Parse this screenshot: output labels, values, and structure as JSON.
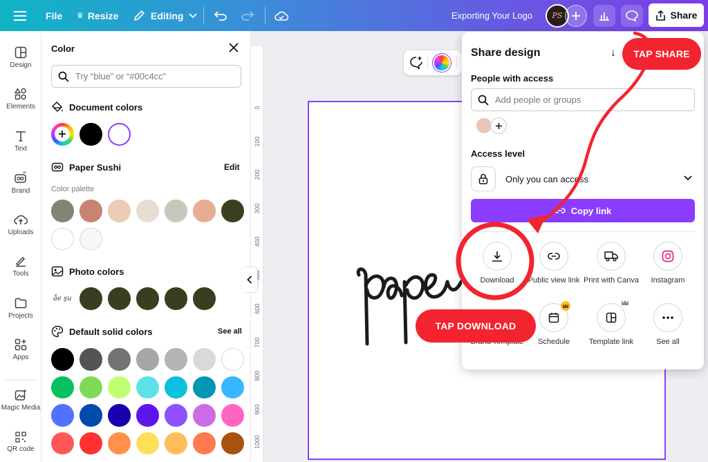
{
  "topbar": {
    "file_label": "File",
    "resize_label": "Resize",
    "editing_label": "Editing",
    "doc_title": "Exporting Your Logo",
    "share_label": "Share",
    "avatar_initials": "PS"
  },
  "rail": {
    "items": [
      {
        "label": "Design",
        "icon": "design-icon"
      },
      {
        "label": "Elements",
        "icon": "elements-icon"
      },
      {
        "label": "Text",
        "icon": "text-icon"
      },
      {
        "label": "Brand",
        "icon": "brand-icon"
      },
      {
        "label": "Uploads",
        "icon": "uploads-icon"
      },
      {
        "label": "Tools",
        "icon": "tools-icon"
      },
      {
        "label": "Projects",
        "icon": "projects-icon"
      },
      {
        "label": "Apps",
        "icon": "apps-icon"
      },
      {
        "label": "Magic Media",
        "icon": "magic-media-icon"
      },
      {
        "label": "QR code",
        "icon": "qr-code-icon"
      }
    ]
  },
  "color_panel": {
    "title": "Color",
    "search_placeholder": "Try “blue” or “#00c4cc”",
    "document_colors_label": "Document colors",
    "document_colors": [
      "#000000",
      "#ffffff"
    ],
    "brand_kit_name": "Paper Sushi",
    "edit_label": "Edit",
    "palette_label": "Color palette",
    "palette": [
      "#838476",
      "#c98372",
      "#ecccb4",
      "#e6ddd3",
      "#c4c9bb",
      "#e7ad92",
      "#3b3f1f",
      "#ffffff",
      "#faf6f4"
    ],
    "photo_colors_label": "Photo colors",
    "photo_thumb_text": "åe şu",
    "photo_colors": [
      "#3a3d20",
      "#3a3d20",
      "#3a3d20",
      "#3a3d20",
      "#3a3d20"
    ],
    "default_colors_label": "Default solid colors",
    "see_all_label": "See all",
    "default_colors": [
      [
        "#000000",
        "#545454",
        "#737373",
        "#a6a6a6",
        "#b4b4b4",
        "#d9d9d9",
        "#ffffff"
      ],
      [
        "#05c15e",
        "#7ed957",
        "#c1ff72",
        "#5ce1e6",
        "#0cc0df",
        "#0097b2",
        "#38b6ff"
      ],
      [
        "#5271ff",
        "#004aad",
        "#1800ad",
        "#5e17eb",
        "#8c52ff",
        "#cb6ce6",
        "#ff66c4"
      ],
      [
        "#ff5757",
        "#ff3131",
        "#ff914d",
        "#ffde59",
        "#ffbd59",
        "#ff7a4d",
        "#a8520f"
      ]
    ]
  },
  "canvas": {
    "ruler_ticks": [
      "0",
      "100",
      "200",
      "300",
      "400",
      "500",
      "600",
      "700",
      "800",
      "900",
      "1000"
    ],
    "logo_text": "paper"
  },
  "share_popup": {
    "title": "Share design",
    "people_label": "People with access",
    "people_placeholder": "Add people or groups",
    "access_label": "Access level",
    "access_value": "Only you can access",
    "copy_link_label": "Copy link",
    "options": [
      {
        "label": "Download",
        "icon": "download-icon"
      },
      {
        "label": "Public view link",
        "icon": "link-icon"
      },
      {
        "label": "Print with Canva",
        "icon": "truck-icon"
      },
      {
        "label": "Instagram",
        "icon": "instagram-icon"
      },
      {
        "label": "Brand Template",
        "icon": "brand-template-icon"
      },
      {
        "label": "Schedule",
        "icon": "calendar-icon"
      },
      {
        "label": "Template link",
        "icon": "template-link-icon"
      },
      {
        "label": "See all",
        "icon": "more-icon"
      }
    ]
  },
  "annotations": {
    "tap_share": "TAP SHARE",
    "tap_download": "TAP DOWNLOAD",
    "color": "#f2242f"
  },
  "colors": {
    "accent": "#8b3dff",
    "topbar_start": "#0fb5c6",
    "topbar_end": "#7d3de6"
  }
}
